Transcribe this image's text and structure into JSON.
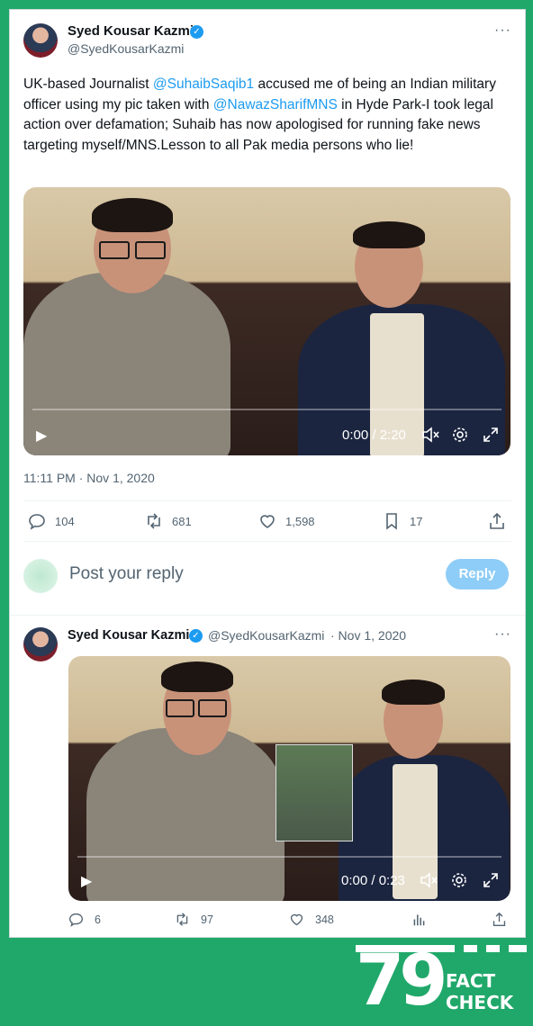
{
  "tweet1": {
    "author_name": "Syed Kousar Kazmi",
    "author_handle": "@SyedKousarKazmi",
    "text_1": "UK-based Journalist ",
    "mention_1": "@SuhaibSaqib1",
    "text_2": " accused me of being an Indian military officer using my pic taken with ",
    "mention_2": "@NawazSharifMNS",
    "text_3": " in Hyde Park-I took legal action over defamation; Suhaib has now apologised for running fake news targeting myself/MNS.Lesson to all Pak media persons who lie!",
    "video_time": "0:00 / 2:20",
    "timestamp": "11:11 PM · Nov 1, 2020",
    "replies": "104",
    "retweets": "681",
    "likes": "1,598",
    "bookmarks": "17"
  },
  "reply_box": {
    "placeholder": "Post your reply",
    "button_label": "Reply"
  },
  "tweet2": {
    "author_name": "Syed Kousar Kazmi",
    "author_handle": "@SyedKousarKazmi",
    "date": "· Nov 1, 2020",
    "video_time": "0:00 / 0:23",
    "replies": "6",
    "retweets": "97",
    "likes": "348"
  },
  "logo": {
    "number": "79",
    "line1": "FACT",
    "line2": "CHECK"
  },
  "colors": {
    "brand_green": "#20a86a",
    "link_blue": "#1d9bf0",
    "verified_blue": "#1d9bf0"
  },
  "icons": [
    "more-icon",
    "verified-icon",
    "play-icon",
    "mute-icon",
    "settings-icon",
    "fullscreen-icon",
    "reply-icon",
    "retweet-icon",
    "like-icon",
    "bookmark-icon",
    "share-icon",
    "views-icon"
  ]
}
